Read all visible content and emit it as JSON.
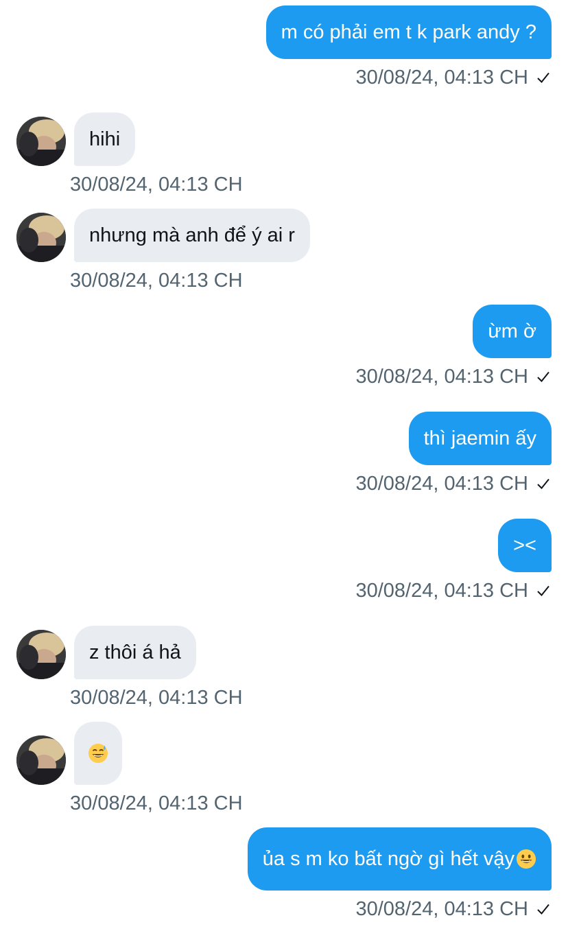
{
  "messages": [
    {
      "direction": "out",
      "text": "m có phải em t k park andy ?",
      "time": "30/08/24, 04:13 CH"
    },
    {
      "direction": "in",
      "text": "hihi",
      "time": "30/08/24, 04:13 CH"
    },
    {
      "direction": "in",
      "text": "nhưng mà anh để ý ai r",
      "time": "30/08/24, 04:13 CH"
    },
    {
      "direction": "out",
      "text": "ừm ờ",
      "time": "30/08/24, 04:13 CH"
    },
    {
      "direction": "out",
      "text": "thì jaemin ấy",
      "time": "30/08/24, 04:13 CH"
    },
    {
      "direction": "out",
      "text": "><",
      "time": "30/08/24, 04:13 CH"
    },
    {
      "direction": "in",
      "text": "z thôi á hả",
      "time": "30/08/24, 04:13 CH"
    },
    {
      "direction": "in",
      "text": "",
      "emoji": "grinning-sweat-emoji",
      "time": "30/08/24, 04:13 CH"
    },
    {
      "direction": "out",
      "text": "ủa s m ko bất ngờ gì hết vậy",
      "emoji": "grinning-emoji",
      "time": "30/08/24, 04:13 CH"
    }
  ],
  "colors": {
    "outgoing_bubble": "#1d9bf0",
    "incoming_bubble": "#e9edf1",
    "timestamp": "#536471"
  },
  "icons": {
    "sent": "check-icon",
    "avatar": "avatar"
  }
}
